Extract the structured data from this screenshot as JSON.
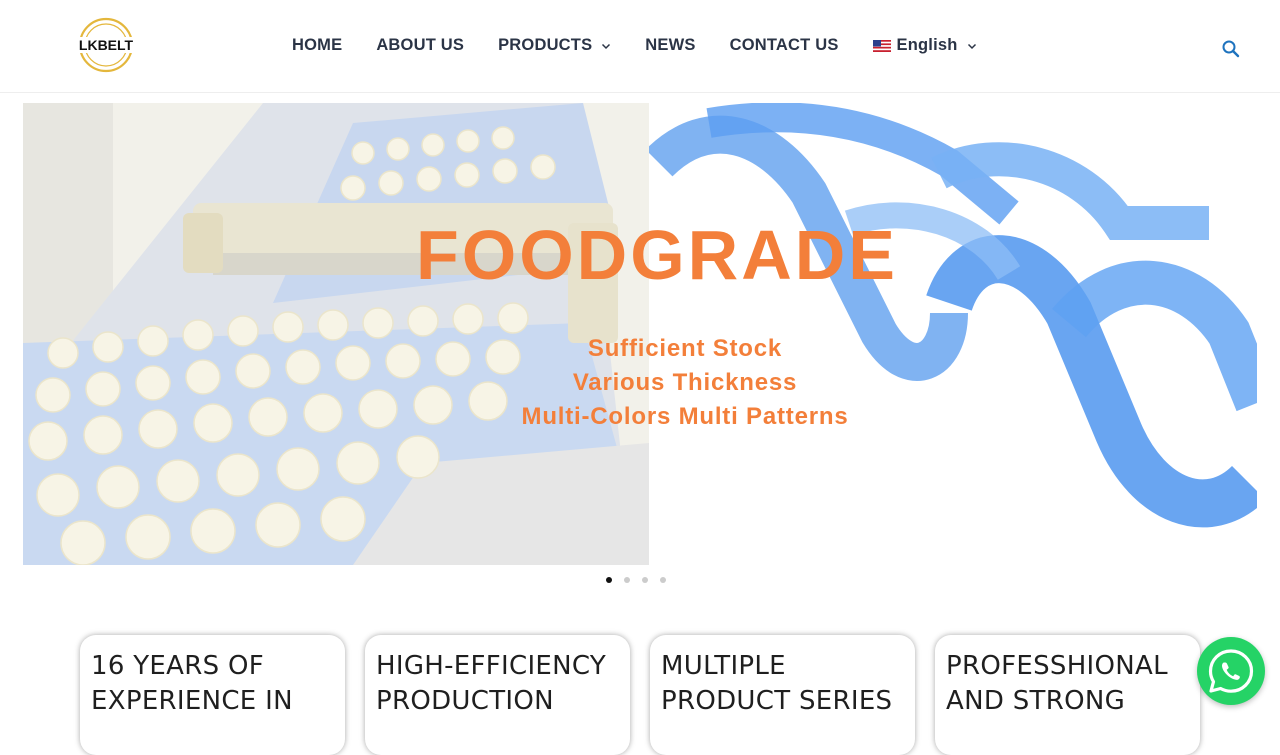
{
  "brand": {
    "logo_text": "LKBELT",
    "ring_color": "#e4b73c"
  },
  "nav": {
    "home": "HOME",
    "about": "ABOUT US",
    "products": "PRODUCTS",
    "news": "NEWS",
    "contact": "CONTACT US",
    "language": "English"
  },
  "hero": {
    "headline": "FOODGRADE",
    "lines": [
      "Sufficient Stock",
      "Various Thickness",
      "Multi-Colors Multi Patterns"
    ],
    "accent_color": "#f37f3a",
    "active_slide": 1,
    "slide_count": 4
  },
  "features": [
    {
      "title": "16 YEARS OF EXPERIENCE IN"
    },
    {
      "title": "HIGH-EFFICIENCY PRODUCTION"
    },
    {
      "title": "MULTIPLE PRODUCT SERIES"
    },
    {
      "title": "PROFESSHIONAL AND STRONG"
    }
  ],
  "icons": {
    "search": "search-icon",
    "whatsapp": "whatsapp-icon",
    "chevron": "chevron-down-icon",
    "flag": "us-flag-icon"
  }
}
